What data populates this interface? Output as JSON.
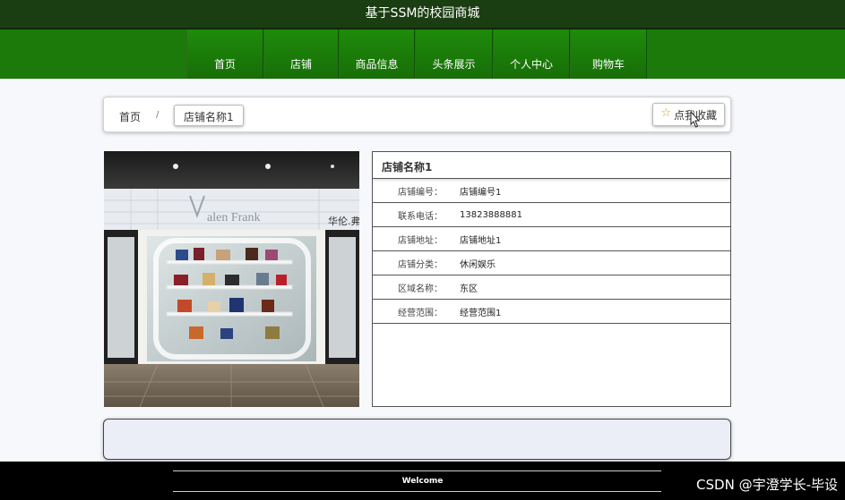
{
  "site": {
    "title": "基于SSM的校园商城"
  },
  "nav": {
    "items": [
      {
        "label": "首页"
      },
      {
        "label": "店铺"
      },
      {
        "label": "商品信息"
      },
      {
        "label": "头条展示"
      },
      {
        "label": "个人中心"
      },
      {
        "label": "购物车"
      }
    ]
  },
  "breadcrumb": {
    "home": "首页",
    "separator": "/",
    "current": "店铺名称1"
  },
  "actions": {
    "favorite_label": "点我收藏",
    "favorite_icon": "star-outline-icon"
  },
  "store": {
    "name": "店铺名称1",
    "fields": [
      {
        "label": "店铺编号：",
        "value": "店铺编号1"
      },
      {
        "label": "联系电话：",
        "value": "13823888881"
      },
      {
        "label": "店铺地址：",
        "value": "店铺地址1"
      },
      {
        "label": "店铺分类：",
        "value": "休闲娱乐"
      },
      {
        "label": "区域名称：",
        "value": "东区"
      },
      {
        "label": "经营范围：",
        "value": "经营范围1"
      }
    ]
  },
  "footer": {
    "text": "Welcome",
    "watermark": "CSDN @宇澄学长-毕设"
  },
  "colors": {
    "nav_green": "#1b7a09",
    "header_dark": "#1b3d12",
    "star": "#d9a400"
  }
}
